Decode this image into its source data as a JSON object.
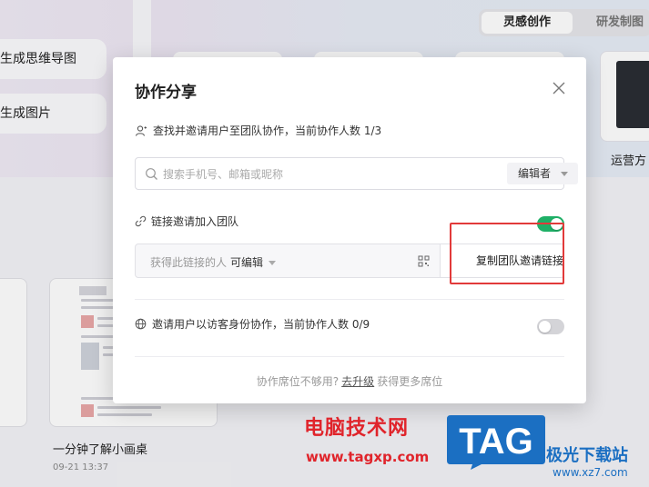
{
  "background": {
    "pills": [
      "生成思维导图",
      "生成图片"
    ],
    "tabs": [
      "灵感创作",
      "研发制图"
    ],
    "template_label": "运营方",
    "doc": {
      "title": "一分钟了解小画桌",
      "date": "09-21 13:37"
    }
  },
  "modal": {
    "title": "协作分享",
    "invite_text": "查找并邀请用户至团队协作，当前协作人数 1/3",
    "search_placeholder": "搜索手机号、邮箱或昵称",
    "role": "编辑者",
    "link_invite_label": "链接邀请加入团队",
    "link_invite_enabled": true,
    "link_perm_prefix": "获得此链接的人",
    "link_perm_value": "可编辑",
    "copy_link_label": "复制团队邀请链接",
    "guest_text": "邀请用户以访客身份协作，当前协作人数 0/9",
    "guest_enabled": false,
    "footer_prefix": "协作席位不够用?",
    "footer_link": "去升级",
    "footer_suffix": "获得更多席位"
  },
  "watermark": {
    "site_name": "电脑技术网",
    "site_url": "www.tagxp.com",
    "logo_text": "TAG",
    "site2_name": "极光下载站",
    "site2_url": "www.xz7.com"
  },
  "colors": {
    "toggle_on": "#1fb067",
    "highlight": "#e23a3a",
    "watermark_red": "#e0242b",
    "logo_blue": "#1b6fc2"
  },
  "icons": [
    "user-icon",
    "search-icon",
    "link-icon",
    "qrcode-icon",
    "globe-icon",
    "close-icon"
  ]
}
